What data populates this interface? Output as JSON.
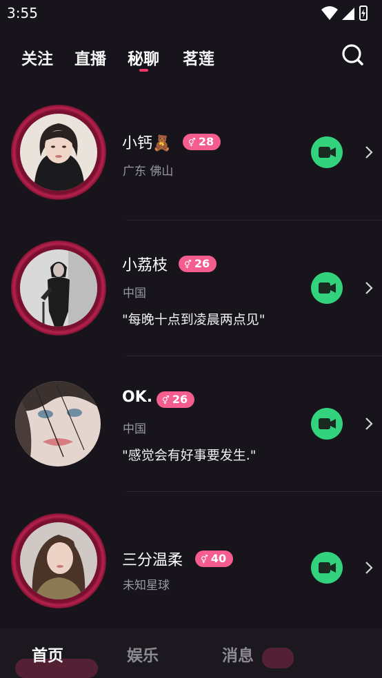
{
  "status": {
    "time": "3:55"
  },
  "tabs": [
    {
      "label": "关注"
    },
    {
      "label": "直播"
    },
    {
      "label": "秘聊",
      "active": true
    },
    {
      "label": "茗莲"
    }
  ],
  "users": [
    {
      "name": "小钙🧸",
      "age": "28",
      "location": "广东 佛山",
      "quote": ""
    },
    {
      "name": "小荔枝",
      "age": "26",
      "location": "中国",
      "quote": "\"每晚十点到凌晨两点见\""
    },
    {
      "name": "OK.",
      "age": "26",
      "location": "中国",
      "quote": "\"感觉会有好事要发生.\""
    },
    {
      "name": "三分温柔",
      "age": "40",
      "location": "未知星球",
      "quote": ""
    }
  ],
  "badge_symbol": "⚥",
  "bottom_nav": [
    {
      "label": "首页",
      "active": true
    },
    {
      "label": "娱乐"
    },
    {
      "label": "消息"
    }
  ],
  "colors": {
    "background": "#17141b",
    "accent": "#f2356b",
    "badge": "#f45d8e",
    "video": "#33d27c"
  }
}
